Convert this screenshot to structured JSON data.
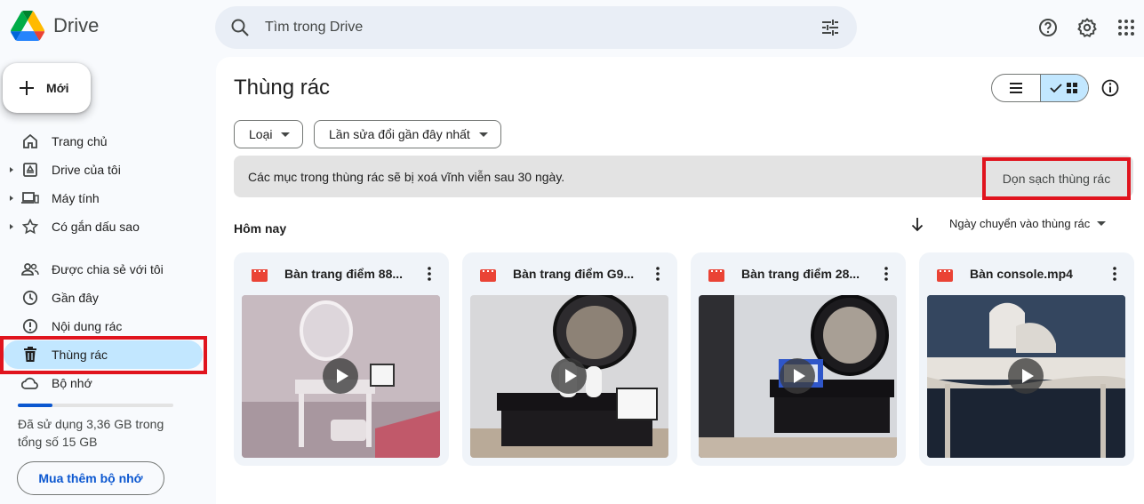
{
  "app": {
    "name": "Drive",
    "logo_icon": "google-drive-logo-icon"
  },
  "search": {
    "placeholder": "Tìm trong Drive",
    "search_icon": "search-icon",
    "filter_icon": "tune-icon"
  },
  "header_icons": [
    "help-icon",
    "settings-icon",
    "apps-grid-icon"
  ],
  "sidebar": {
    "new_label": "Mới",
    "items": [
      {
        "label": "Trang chủ",
        "icon": "home-icon",
        "expandable": false
      },
      {
        "label": "Drive của tôi",
        "icon": "my-drive-icon",
        "expandable": true
      },
      {
        "label": "Máy tính",
        "icon": "computer-icon",
        "expandable": true
      },
      {
        "label": "Có gắn dấu sao",
        "icon": "star-icon",
        "expandable": true
      },
      {
        "label": "Được chia sẻ với tôi",
        "icon": "people-icon",
        "expandable": false
      },
      {
        "label": "Gần đây",
        "icon": "clock-icon",
        "expandable": false
      },
      {
        "label": "Nội dung rác",
        "icon": "spam-icon",
        "expandable": false
      },
      {
        "label": "Thùng rác",
        "icon": "trash-icon",
        "expandable": false,
        "active": true
      },
      {
        "label": "Bộ nhớ",
        "icon": "cloud-icon",
        "expandable": false
      }
    ],
    "storage": {
      "text": "Đã sử dụng 3,36 GB trong tổng số 15 GB",
      "used_fraction": 0.224
    },
    "buy_label": "Mua thêm bộ nhớ"
  },
  "main": {
    "title": "Thùng rác",
    "filters": [
      {
        "label": "Loại"
      },
      {
        "label": "Lần sửa đổi gần đây nhất"
      }
    ],
    "banner": {
      "text": "Các mục trong thùng rác sẽ bị xoá vĩnh viễn sau 30 ngày.",
      "action": "Dọn sạch thùng rác"
    },
    "section": "Hôm nay",
    "sort_label": "Ngày chuyển vào thùng rác",
    "files": [
      {
        "name": "Bàn trang điểm 88...",
        "icon": "video-file-icon"
      },
      {
        "name": "Bàn trang điểm G9...",
        "icon": "video-file-icon"
      },
      {
        "name": "Bàn trang điểm 28...",
        "icon": "video-file-icon"
      },
      {
        "name": "Bàn console.mp4",
        "icon": "video-file-icon"
      }
    ]
  },
  "colors": {
    "accent": "#0b57d0",
    "active_nav": "#c2e7ff",
    "highlight_box": "#e0141e",
    "video_icon": "#ea4335"
  }
}
